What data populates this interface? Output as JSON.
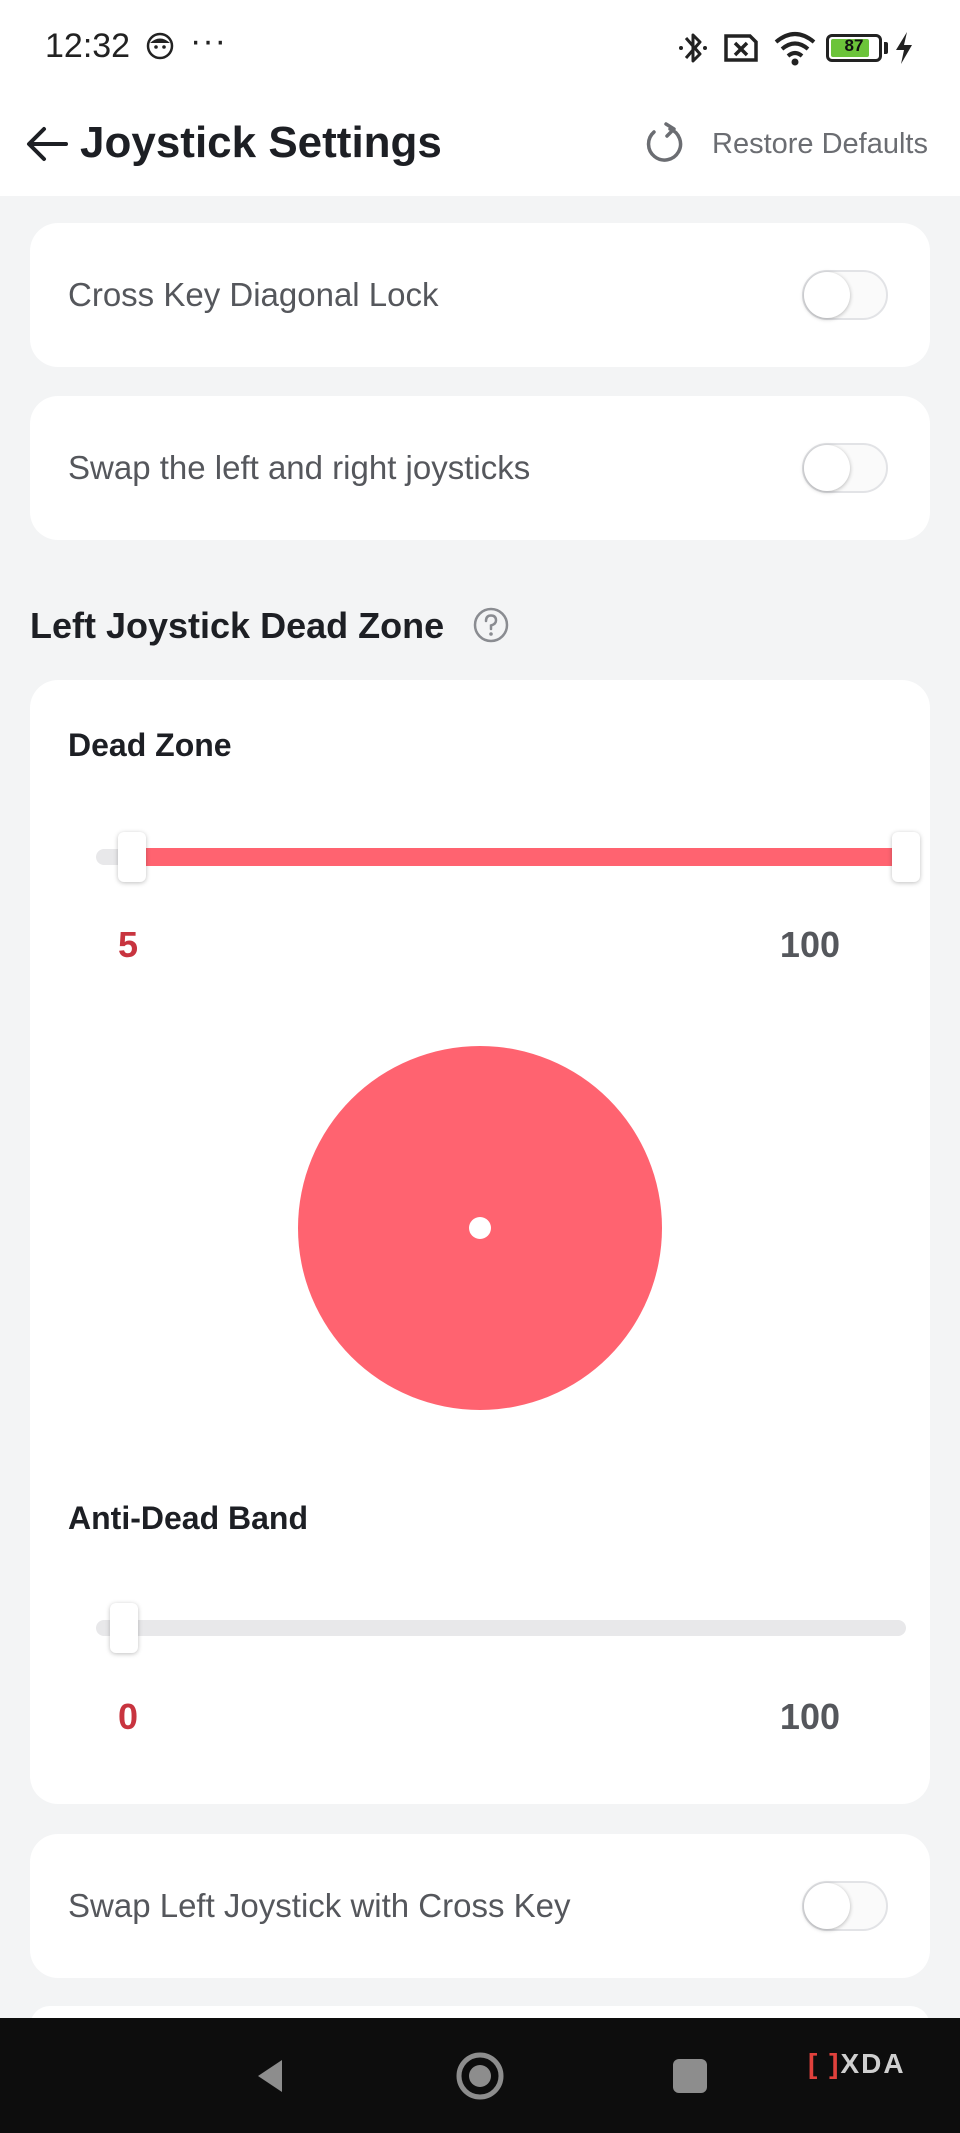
{
  "status_bar": {
    "time": "12:32",
    "more": "···",
    "battery_level": "87",
    "icons": [
      "face-icon",
      "bluetooth-icon",
      "no-sim-icon",
      "wifi-icon",
      "battery-icon",
      "charging-icon"
    ]
  },
  "header": {
    "title": "Joystick Settings",
    "restore_label": "Restore Defaults"
  },
  "settings": {
    "cross_key_lock": {
      "label": "Cross Key Diagonal Lock",
      "enabled": false
    },
    "swap_joysticks": {
      "label": "Swap the left and right joysticks",
      "enabled": false
    },
    "swap_left_cross": {
      "label": "Swap Left Joystick with Cross Key",
      "enabled": false
    }
  },
  "left_dead_zone": {
    "section_title": "Left Joystick Dead Zone",
    "dead_zone": {
      "label": "Dead Zone",
      "min_value": "5",
      "max_value": "100",
      "range_min": 0,
      "range_max": 100
    },
    "anti_dead_band": {
      "label": "Anti-Dead Band",
      "min_value": "0",
      "max_value": "100",
      "range_min": 0,
      "range_max": 100
    }
  },
  "watermark": {
    "mark": "[ ]",
    "text": "XDA"
  },
  "colors": {
    "accent": "#ff6370",
    "accent_text": "#c8343f",
    "background": "#f3f4f5"
  }
}
